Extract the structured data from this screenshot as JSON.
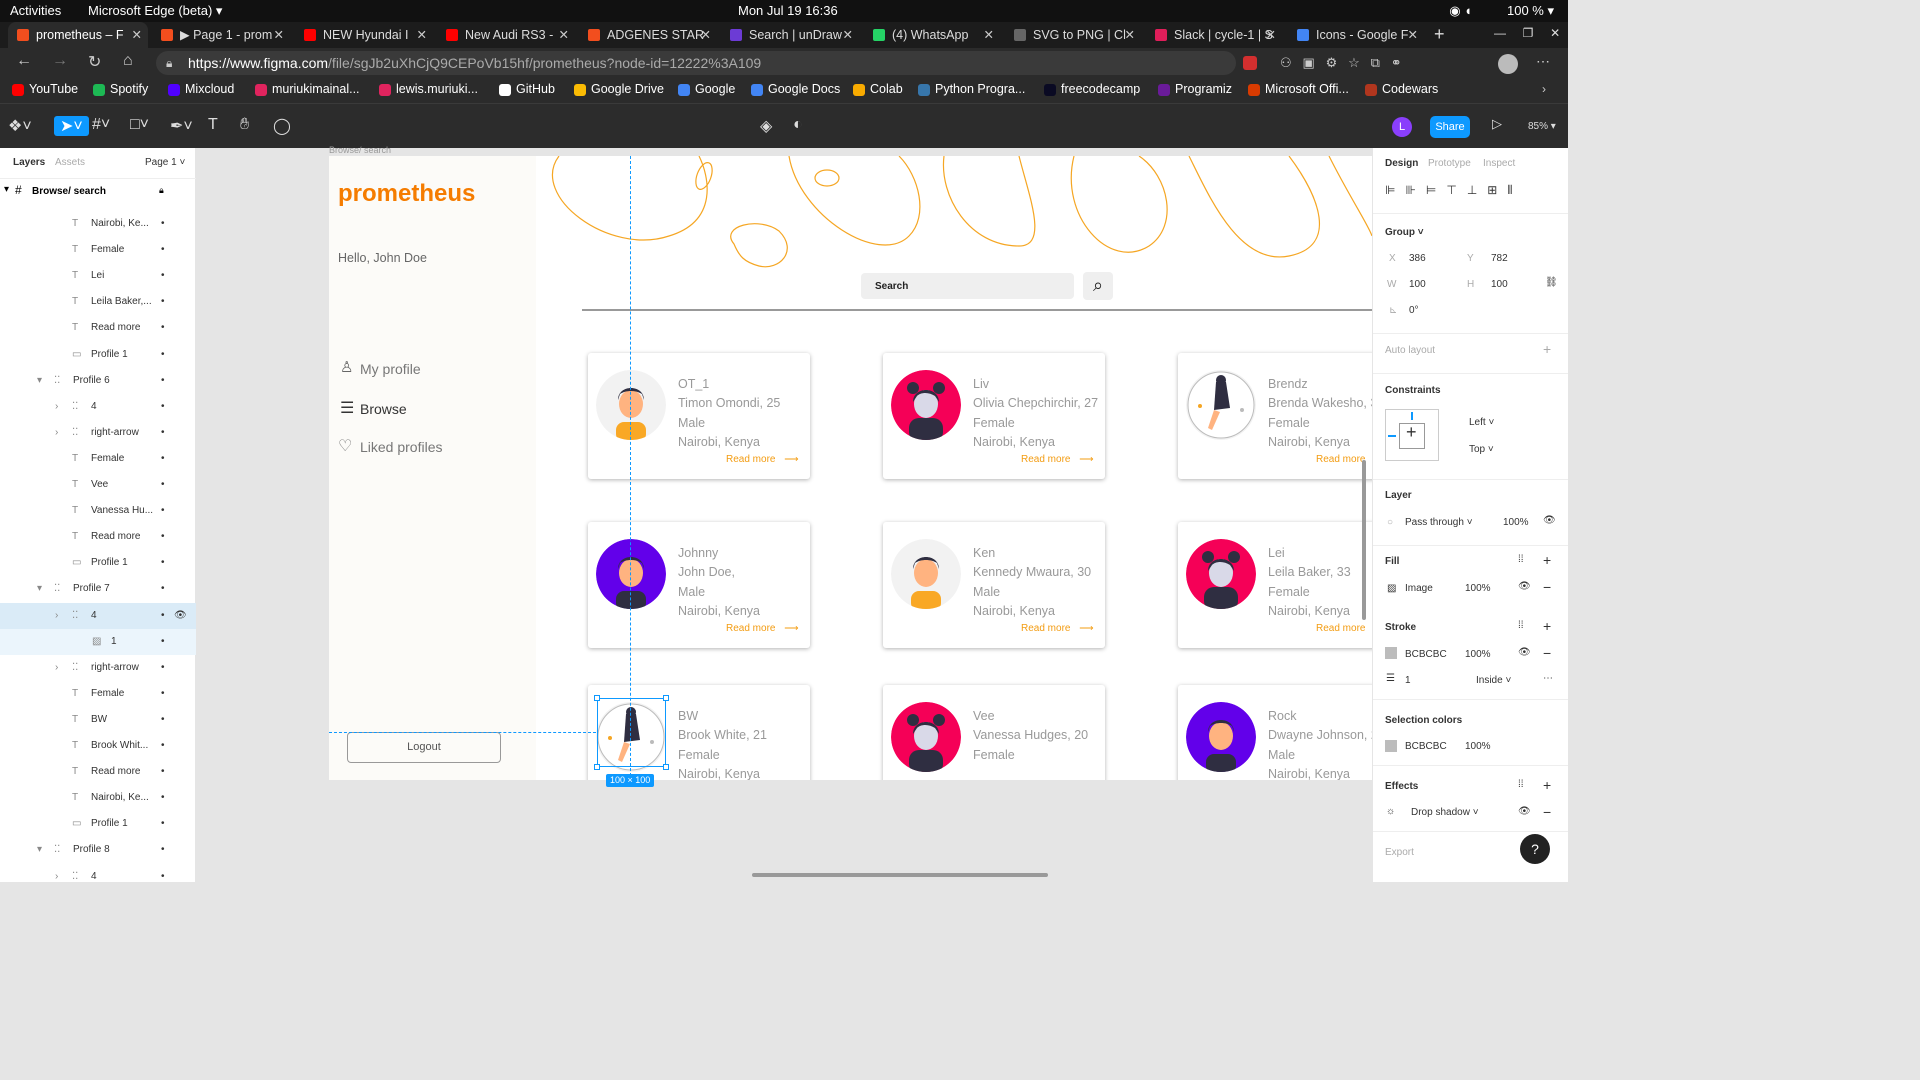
{
  "gnome": {
    "activities": "Activities",
    "app": "Microsoft Edge (beta) ▾",
    "clock": "Mon Jul 19  16:36",
    "battery": "100 % ▾"
  },
  "tabs": [
    {
      "label": "prometheus – F",
      "color": "#f24e1e"
    },
    {
      "label": "▶ Page 1 - prom",
      "color": "#f24e1e"
    },
    {
      "label": "NEW Hyundai I",
      "color": "#ff0000"
    },
    {
      "label": "New Audi RS3 -",
      "color": "#ff0000"
    },
    {
      "label": "ADGENES STAR",
      "color": "#f24e1e"
    },
    {
      "label": "Search | unDraw",
      "color": "#6c3bd5"
    },
    {
      "label": "(4) WhatsApp",
      "color": "#25d366"
    },
    {
      "label": "SVG to PNG | Cl",
      "color": "#666"
    },
    {
      "label": "Slack | cycle-1 | S",
      "color": "#e01e5a"
    },
    {
      "label": "Icons - Google F",
      "color": "#4285f4"
    }
  ],
  "address": {
    "prefix": "https://www.figma.com",
    "rest": "/file/sgJb2uXhCjQ9CEPoVb15hf/prometheus?node-id=12222%3A109"
  },
  "bookmarks": [
    {
      "label": "YouTube",
      "color": "#ff0000"
    },
    {
      "label": "Spotify",
      "color": "#1db954"
    },
    {
      "label": "Mixcloud",
      "color": "#5000ff"
    },
    {
      "label": "muriukimainal...",
      "color": "#e0245e"
    },
    {
      "label": "lewis.muriuki...",
      "color": "#e0245e"
    },
    {
      "label": "GitHub",
      "color": "#ffffff"
    },
    {
      "label": "Google Drive",
      "color": "#fbbc04"
    },
    {
      "label": "Google",
      "color": "#4285f4"
    },
    {
      "label": "Google Docs",
      "color": "#4285f4"
    },
    {
      "label": "Colab",
      "color": "#f9ab00"
    },
    {
      "label": "Python Progra...",
      "color": "#3776ab"
    },
    {
      "label": "freecodecamp",
      "color": "#0a0a23"
    },
    {
      "label": "Programiz",
      "color": "#6a1b9a"
    },
    {
      "label": "Microsoft Offi...",
      "color": "#d83b01"
    },
    {
      "label": "Codewars",
      "color": "#b1361e"
    }
  ],
  "figma": {
    "share": "Share",
    "zoom": "85% ▾",
    "user_initial": "L"
  },
  "layers": {
    "tab_layers": "Layers",
    "tab_assets": "Assets",
    "page": "Page 1 ˅",
    "frame": "Browse/ search",
    "rows": [
      {
        "label": "Nairobi, Ke...",
        "type": "T",
        "indent": 1
      },
      {
        "label": "Female",
        "type": "T",
        "indent": 1
      },
      {
        "label": "Lei",
        "type": "T",
        "indent": 1
      },
      {
        "label": "Leila Baker,...",
        "type": "T",
        "indent": 1
      },
      {
        "label": "Read more",
        "type": "T",
        "indent": 1
      },
      {
        "label": "Profile 1",
        "type": "R",
        "indent": 1
      },
      {
        "label": "Profile 6",
        "type": "G",
        "indent": 0
      },
      {
        "label": "4",
        "type": "G",
        "indent": 1
      },
      {
        "label": "right-arrow",
        "type": "G",
        "indent": 1
      },
      {
        "label": "Female",
        "type": "T",
        "indent": 1
      },
      {
        "label": "Vee",
        "type": "T",
        "indent": 1
      },
      {
        "label": "Vanessa Hu...",
        "type": "T",
        "indent": 1
      },
      {
        "label": "Read more",
        "type": "T",
        "indent": 1
      },
      {
        "label": "Profile 1",
        "type": "R",
        "indent": 1
      },
      {
        "label": "Profile 7",
        "type": "G",
        "indent": 0
      },
      {
        "label": "4",
        "type": "G",
        "indent": 1
      },
      {
        "label": "1",
        "type": "I",
        "indent": 2
      },
      {
        "label": "right-arrow",
        "type": "G",
        "indent": 1
      },
      {
        "label": "Female",
        "type": "T",
        "indent": 1
      },
      {
        "label": "BW",
        "type": "T",
        "indent": 1
      },
      {
        "label": "Brook Whit...",
        "type": "T",
        "indent": 1
      },
      {
        "label": "Read more",
        "type": "T",
        "indent": 1
      },
      {
        "label": "Nairobi, Ke...",
        "type": "T",
        "indent": 1
      },
      {
        "label": "Profile 1",
        "type": "R",
        "indent": 1
      },
      {
        "label": "Profile 8",
        "type": "G",
        "indent": 0
      },
      {
        "label": "4",
        "type": "G",
        "indent": 1
      }
    ]
  },
  "canvas": {
    "frame_label": "Browse/ search",
    "selection_size": "100 × 100"
  },
  "app": {
    "logo": "prometheus",
    "greeting": "Hello, John Doe",
    "nav": [
      "My profile",
      "Browse",
      "Liked profiles"
    ],
    "logout": "Logout",
    "search_placeholder": "Search",
    "read_more": "Read more"
  },
  "profiles": [
    {
      "nick": "OT_1",
      "name": "Timon Omondi, 25",
      "gender": "Male",
      "location": "Nairobi, Kenya",
      "avatar": "male",
      "bg": "#f2f2f2"
    },
    {
      "nick": "Liv",
      "name": "Olivia Chepchirchir, 27",
      "gender": "Female",
      "location": "Nairobi, Kenya",
      "avatar": "female",
      "bg": "#f50057"
    },
    {
      "nick": "Brendz",
      "name": "Brenda Wakesho, 3",
      "gender": "Female",
      "location": "Nairobi, Kenya",
      "avatar": "sitting",
      "bg": "#f2f2f2"
    },
    {
      "nick": "Johnny",
      "name": "John Doe,",
      "gender": "Male",
      "location": "Nairobi, Kenya",
      "avatar": "male",
      "bg": "#6200ea"
    },
    {
      "nick": "Ken",
      "name": "Kennedy Mwaura, 30",
      "gender": "Male",
      "location": "Nairobi, Kenya",
      "avatar": "male",
      "bg": "#f2f2f2"
    },
    {
      "nick": "Lei",
      "name": "Leila Baker, 33",
      "gender": "Female",
      "location": "Nairobi, Kenya",
      "avatar": "female",
      "bg": "#f50057"
    },
    {
      "nick": "BW",
      "name": "Brook White, 21",
      "gender": "Female",
      "location": "Nairobi, Kenya",
      "avatar": "sitting",
      "bg": "#f2f2f2"
    },
    {
      "nick": "Vee",
      "name": "Vanessa Hudges, 20",
      "gender": "Female",
      "location": "",
      "avatar": "female",
      "bg": "#f50057"
    },
    {
      "nick": "Rock",
      "name": "Dwayne Johnson, 2",
      "gender": "Male",
      "location": "Nairobi, Kenya",
      "avatar": "male",
      "bg": "#6200ea"
    }
  ],
  "design": {
    "tabs": [
      "Design",
      "Prototype",
      "Inspect"
    ],
    "group": "Group ˅",
    "x": "386",
    "y": "782",
    "w": "100",
    "h": "100",
    "rotation": "0°",
    "auto_layout": "Auto layout",
    "constraints": "Constraints",
    "c_h": "Left ˅",
    "c_v": "Top ˅",
    "layer": "Layer",
    "blend": "Pass through ˅",
    "layer_opacity": "100%",
    "fill": "Fill",
    "fill_type": "Image",
    "fill_opacity": "100%",
    "stroke": "Stroke",
    "stroke_color": "BCBCBC",
    "stroke_opacity": "100%",
    "stroke_weight": "1",
    "stroke_pos": "Inside ˅",
    "selection_colors": "Selection colors",
    "sel_color": "BCBCBC",
    "sel_opacity": "100%",
    "effects": "Effects",
    "effect": "Drop shadow ˅",
    "export": "Export",
    "help": "?"
  }
}
